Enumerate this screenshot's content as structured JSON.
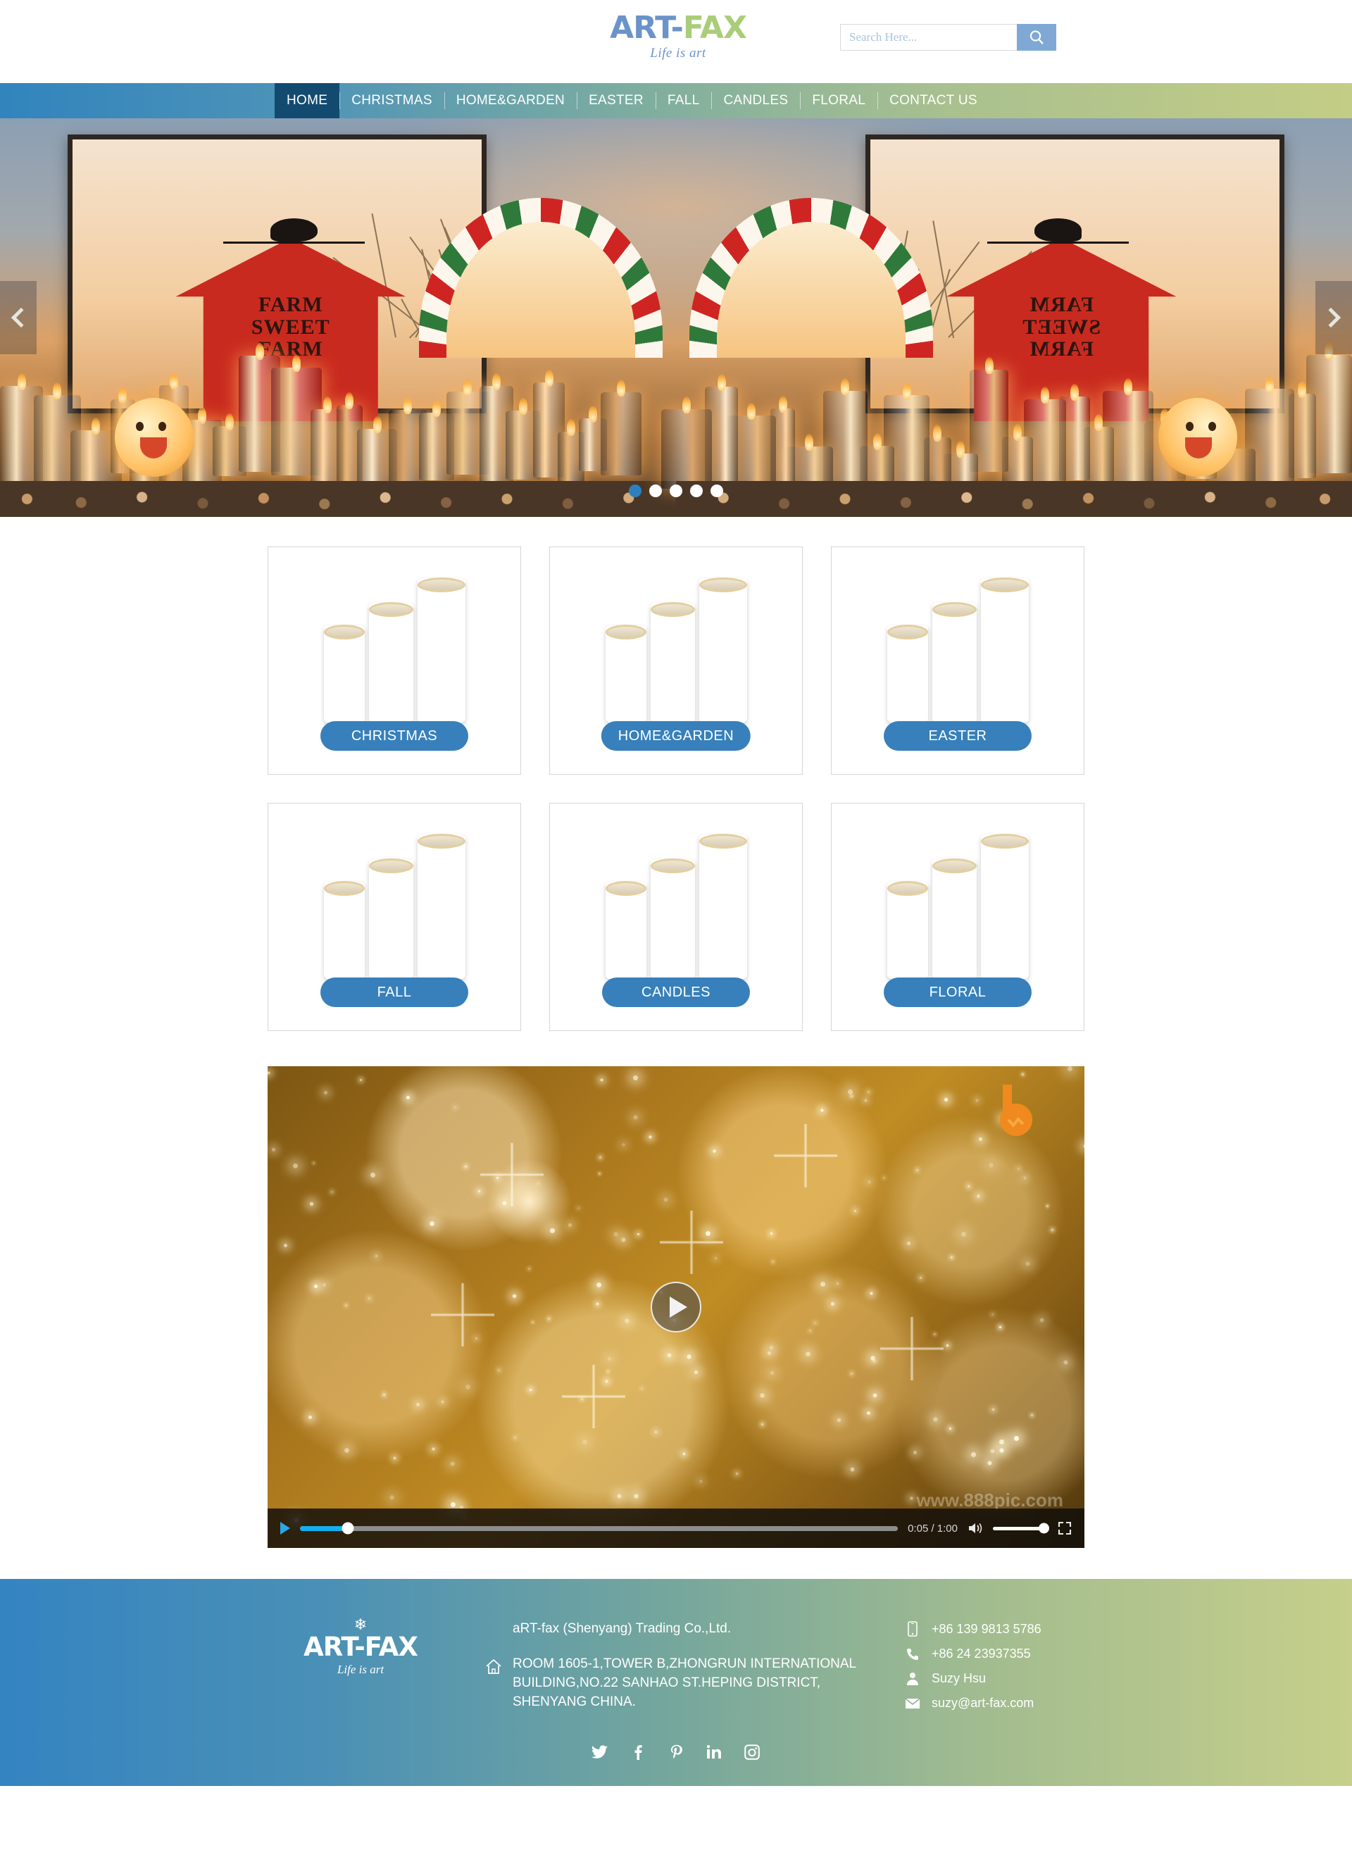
{
  "header": {
    "logo": {
      "part1": "ART-",
      "part2": "FAX",
      "tagline": "Life is art"
    },
    "search": {
      "placeholder": "Search Here...",
      "value": "",
      "icon": "search-icon"
    }
  },
  "nav": {
    "items": [
      {
        "label": "HOME",
        "active": true
      },
      {
        "label": "CHRISTMAS",
        "active": false
      },
      {
        "label": "HOME&GARDEN",
        "active": false
      },
      {
        "label": "EASTER",
        "active": false
      },
      {
        "label": "FALL",
        "active": false
      },
      {
        "label": "CANDLES",
        "active": false
      },
      {
        "label": "FLORAL",
        "active": false
      },
      {
        "label": "CONTACT US",
        "active": false
      }
    ]
  },
  "hero": {
    "prev_icon": "chevron-left-icon",
    "next_icon": "chevron-right-icon",
    "sign_line1": "FARM",
    "sign_line2": "SWEET",
    "sign_line3": "FARM",
    "slides_count": 5,
    "active_slide": 1
  },
  "categories": [
    {
      "label": "CHRISTMAS"
    },
    {
      "label": "HOME&GARDEN"
    },
    {
      "label": "EASTER"
    },
    {
      "label": "FALL"
    },
    {
      "label": "CANDLES"
    },
    {
      "label": "FLORAL"
    }
  ],
  "video": {
    "play_icon": "play-icon",
    "current_time": "0:05",
    "duration": "1:00",
    "time_display": "0:05 / 1:00",
    "progress_percent": 8,
    "volume_icon": "volume-icon",
    "fullscreen_icon": "fullscreen-icon",
    "watermark": "www.888pic.com",
    "brand_mark": "b-logo-icon"
  },
  "footer": {
    "logo": {
      "part1": "ART-",
      "part2": "FAX",
      "tagline": "Life is art",
      "decoration": "snowflake-icon"
    },
    "company": "aRT-fax (Shenyang) Trading Co.,Ltd.",
    "address_icon": "home-icon",
    "address": "ROOM 1605-1,TOWER B,ZHONGRUN INTERNATIONAL BUILDING,NO.22 SANHAO ST.HEPING DISTRICT, SHENYANG CHINA.",
    "contacts": [
      {
        "icon": "mobile-icon",
        "value": "+86 139 9813 5786"
      },
      {
        "icon": "phone-icon",
        "value": "+86 24 23937355"
      },
      {
        "icon": "person-icon",
        "value": "Suzy Hsu"
      },
      {
        "icon": "envelope-icon",
        "value": "suzy@art-fax.com"
      }
    ],
    "socials": [
      {
        "name": "twitter-icon"
      },
      {
        "name": "facebook-icon"
      },
      {
        "name": "pinterest-icon"
      },
      {
        "name": "linkedin-icon"
      },
      {
        "name": "instagram-icon"
      }
    ]
  },
  "colors": {
    "brand_blue": "#6b93c9",
    "brand_green": "#a9cd7a",
    "nav_start": "#3184bd",
    "nav_end": "#c4cd85",
    "active_nav": "#134b70",
    "button_blue": "#3780bb",
    "footer_start": "#3484c2",
    "footer_end": "#c6cf8b"
  }
}
